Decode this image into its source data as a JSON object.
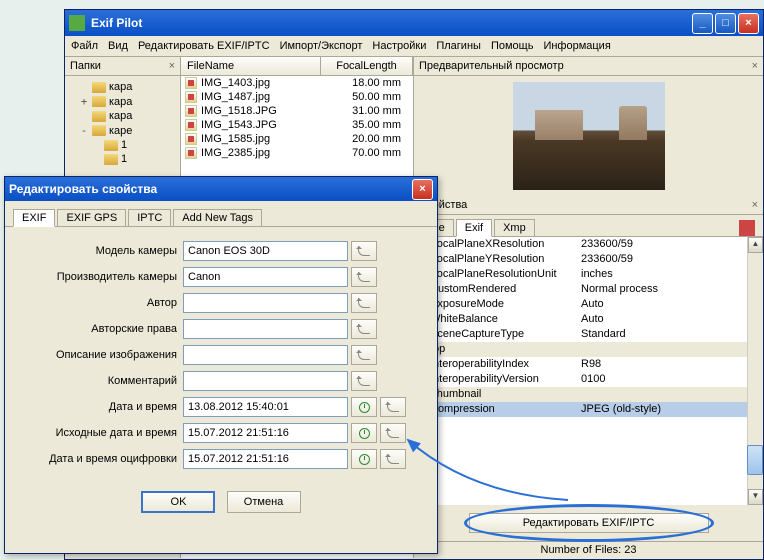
{
  "app": {
    "title": "Exif Pilot"
  },
  "menu": [
    "Файл",
    "Вид",
    "Редактировать EXIF/IPTC",
    "Импорт/Экспорт",
    "Настройки",
    "Плагины",
    "Помощь",
    "Информация"
  ],
  "folders": {
    "header": "Папки",
    "items": [
      {
        "indent": 1,
        "toggle": "",
        "label": "кара"
      },
      {
        "indent": 1,
        "toggle": "+",
        "label": "кара"
      },
      {
        "indent": 1,
        "toggle": "",
        "label": "кара"
      },
      {
        "indent": 1,
        "toggle": "-",
        "label": "каре"
      },
      {
        "indent": 2,
        "toggle": "",
        "label": "1"
      },
      {
        "indent": 2,
        "toggle": "",
        "label": "1"
      }
    ]
  },
  "table": {
    "cols": [
      "FileName",
      "FocalLength"
    ],
    "rows": [
      {
        "fn": "IMG_1403.jpg",
        "fl": "18.00 mm"
      },
      {
        "fn": "IMG_1487.jpg",
        "fl": "50.00 mm"
      },
      {
        "fn": "IMG_1518.JPG",
        "fl": "31.00 mm"
      },
      {
        "fn": "IMG_1543.JPG",
        "fl": "35.00 mm"
      },
      {
        "fn": "IMG_1585.jpg",
        "fl": "20.00 mm"
      },
      {
        "fn": "IMG_2385.jpg",
        "fl": "70.00 mm"
      }
    ]
  },
  "preview": {
    "header": "Предварительный просмотр"
  },
  "props": {
    "header": "Свойства",
    "tabs": [
      "File",
      "Exif",
      "Xmp"
    ],
    "rows": [
      {
        "k": "FocalPlaneXResolution",
        "v": "233600/59"
      },
      {
        "k": "FocalPlaneYResolution",
        "v": "233600/59"
      },
      {
        "k": "FocalPlaneResolutionUnit",
        "v": "inches"
      },
      {
        "k": "CustomRendered",
        "v": "Normal process"
      },
      {
        "k": "ExposureMode",
        "v": "Auto"
      },
      {
        "k": "WhiteBalance",
        "v": "Auto"
      },
      {
        "k": "SceneCaptureType",
        "v": "Standard"
      },
      {
        "hdr": true,
        "tg": "-",
        "k": "Iop"
      },
      {
        "k": "InteroperabilityIndex",
        "v": "R98"
      },
      {
        "k": "InteroperabilityVersion",
        "v": "0100"
      },
      {
        "hdr": true,
        "tg": "-",
        "k": "Thumbnail"
      },
      {
        "k": "Compression",
        "v": "JPEG (old-style)",
        "sel": true
      }
    ],
    "edit_btn": "Редактировать EXIF/IPTC"
  },
  "status": "Number of Files: 23",
  "dialog": {
    "title": "Редактировать свойства",
    "tabs": [
      "EXIF",
      "EXIF GPS",
      "IPTC",
      "Add New Tags"
    ],
    "fields": [
      {
        "lbl": "Модель камеры",
        "val": "Canon EOS 30D",
        "btns": [
          "undo"
        ]
      },
      {
        "lbl": "Производитель камеры",
        "val": "Canon",
        "btns": [
          "undo"
        ]
      },
      {
        "lbl": "Автор",
        "val": "",
        "btns": [
          "undo"
        ]
      },
      {
        "lbl": "Авторские права",
        "val": "",
        "btns": [
          "undo"
        ]
      },
      {
        "lbl": "Описание изображения",
        "val": "",
        "btns": [
          "undo"
        ]
      },
      {
        "lbl": "Комментарий",
        "val": "",
        "btns": [
          "undo"
        ]
      },
      {
        "lbl": "Дата и время",
        "val": "13.08.2012 15:40:01",
        "btns": [
          "clock",
          "undo"
        ]
      },
      {
        "lbl": "Исходные дата и время",
        "val": "15.07.2012 21:51:16",
        "btns": [
          "clock",
          "undo"
        ]
      },
      {
        "lbl": "Дата и время оцифровки",
        "val": "15.07.2012 21:51:16",
        "btns": [
          "clock",
          "undo"
        ]
      }
    ],
    "ok": "OK",
    "cancel": "Отмена"
  }
}
